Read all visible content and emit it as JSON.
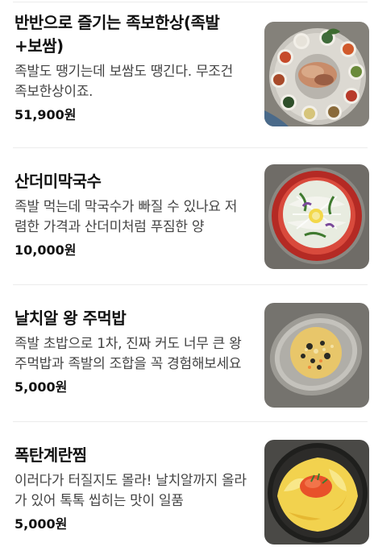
{
  "menu": {
    "items": [
      {
        "name": "반반으로 즐기는 족보한상(족발+보쌈)",
        "description": "족발도 땡기는데 보쌈도 땡긴다. 무조건 족보한상이죠.",
        "price": "51,900원",
        "photo_icon": "jokbal-bossam-platter-photo"
      },
      {
        "name": "산더미막국수",
        "description": "족발 먹는데 막국수가 빠질 수 있나요 저렴한 가격과 산더미처럼 푸짐한 양",
        "price": "10,000원",
        "photo_icon": "makguksu-photo"
      },
      {
        "name": "날치알 왕 주먹밥",
        "description": "족발 초밥으로 1차, 진짜 커도 너무 큰 왕주먹밥과 족발의 조합을 꼭 경험해보세요",
        "price": "5,000원",
        "photo_icon": "rice-ball-photo"
      },
      {
        "name": "폭탄계란찜",
        "description": "이러다가 터질지도 몰라! 날치알까지 올라가 있어 톡톡 씹히는 맛이 일품",
        "price": "5,000원",
        "photo_icon": "steamed-egg-photo"
      }
    ]
  }
}
